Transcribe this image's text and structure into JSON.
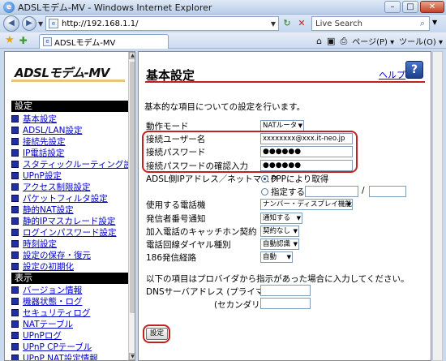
{
  "window": {
    "title": "ADSLモデム-MV - Windows Internet Explorer"
  },
  "browser": {
    "url": "http://192.168.1.1/",
    "search_placeholder": "Live Search",
    "tab_title": "ADSLモデム-MV",
    "cmd_page": "ページ(P)",
    "cmd_tools": "ツール(O)"
  },
  "left": {
    "logo": "ADSLモデム-MV",
    "settings_head": "設定",
    "settings_items": [
      "基本設定",
      "ADSL/LAN設定",
      "接続先設定",
      "IP電話設定",
      "スタティックルーティング設定",
      "UPnP設定",
      "アクセス制限設定",
      "パケットフィルタ設定",
      "静的NAT設定",
      "静的IPマスカレード設定",
      "ログインパスワード設定",
      "時刻設定",
      "設定の保存・復元",
      "設定の初期化"
    ],
    "display_head": "表示",
    "display_items": [
      "バージョン情報",
      "機器状態・ログ",
      "セキュリティログ",
      "NATテーブル",
      "UPnPログ",
      "UPnP CPテーブル",
      "UPnP NAT設定情報"
    ]
  },
  "main": {
    "title": "基本設定",
    "help_label": "ヘルプ",
    "intro": "基本的な項目についての設定を行います。",
    "op_mode": {
      "label": "動作モード",
      "value": "NATルータ"
    },
    "username": {
      "label": "接続ユーザー名",
      "value": "xxxxxxxx@xxx.it-neo.jp"
    },
    "password": {
      "label": "接続パスワード",
      "value": "●●●●●●"
    },
    "password_confirm": {
      "label": "接続パスワードの確認入力",
      "value": "●●●●●●"
    },
    "wan_ip": {
      "label": "ADSL側IPアドレス／ネットマスク",
      "option_ppp": "PPPにより取得",
      "option_manual": "指定する",
      "slash": "/"
    },
    "phone_device": {
      "label": "使用する電話機",
      "value": "ナンバー・ディスプレイ機能なし"
    },
    "caller_id": {
      "label": "発信者番号通知",
      "value": "通知する"
    },
    "catch_phone": {
      "label": "加入電話のキャッチホン契約",
      "value": "契約なし"
    },
    "dial_type": {
      "label": "電話回線ダイヤル種別",
      "value": "自動認識"
    },
    "route_186": {
      "label": "186発信経路",
      "value": "自動"
    },
    "dns_note": "以下の項目はプロバイダから指示があった場合に入力してください。",
    "dns_primary": {
      "label": "DNSサーバアドレス (プライマリ)",
      "value": ""
    },
    "dns_secondary": {
      "label": "(セカンダリ)",
      "value": ""
    },
    "submit_label": "設定"
  }
}
